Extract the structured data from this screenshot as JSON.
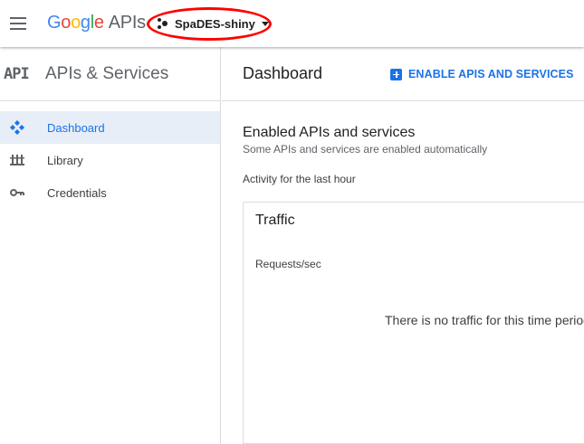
{
  "topbar": {
    "logo_letters": [
      "G",
      "o",
      "o",
      "g",
      "l",
      "e"
    ],
    "logo_suffix": "APIs",
    "project_name": "SpaDES-shiny"
  },
  "sidebar": {
    "badge": "API",
    "title": "APIs & Services",
    "items": [
      {
        "label": "Dashboard",
        "icon": "dashboard-icon",
        "active": true
      },
      {
        "label": "Library",
        "icon": "library-icon",
        "active": false
      },
      {
        "label": "Credentials",
        "icon": "key-icon",
        "active": false
      }
    ]
  },
  "main": {
    "title": "Dashboard",
    "enable_button": "ENABLE APIS AND SERVICES",
    "section_title": "Enabled APIs and services",
    "section_subtitle": "Some APIs and services are enabled automatically",
    "activity_label": "Activity for the last hour",
    "traffic_card": {
      "title": "Traffic",
      "axis_label": "Requests/sec",
      "empty_message": "There is no traffic for this time period"
    }
  },
  "colors": {
    "accent": "#1a73e8",
    "active_bg": "#e8eef7",
    "highlight_oval": "#ff0000"
  }
}
